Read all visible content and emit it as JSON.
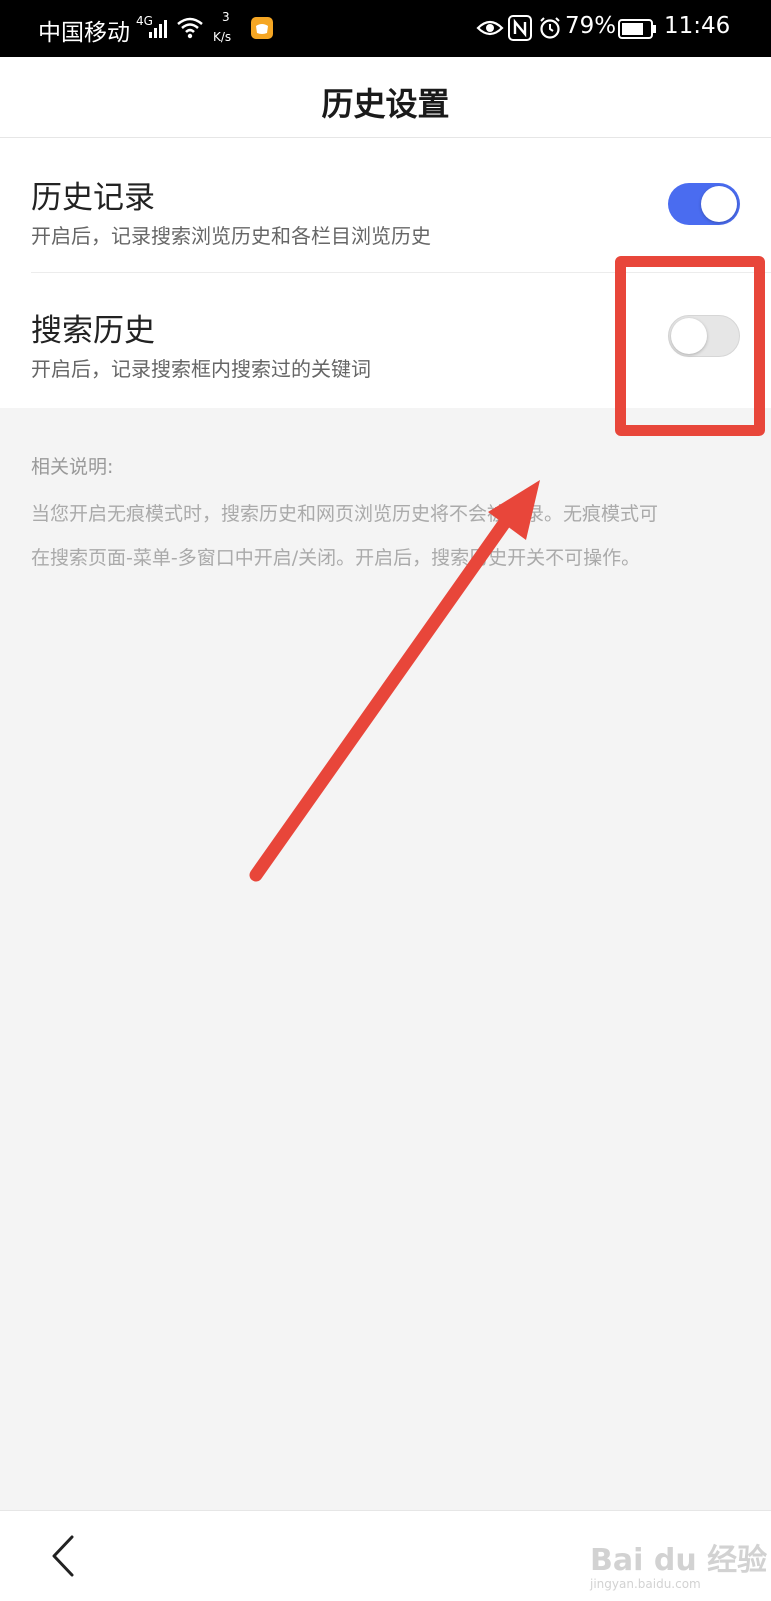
{
  "status_bar": {
    "carrier": "中国移动",
    "network": "4G",
    "speed_value": "3",
    "speed_unit": "K/s",
    "battery": "79%",
    "time": "11:46"
  },
  "header": {
    "title": "历史设置"
  },
  "settings": [
    {
      "label": "历史记录",
      "desc": "开启后，记录搜索浏览历史和各栏目浏览历史",
      "enabled": true
    },
    {
      "label": "搜索历史",
      "desc": "开启后，记录搜索框内搜索过的关键词",
      "enabled": false
    }
  ],
  "notes": {
    "title": "相关说明:",
    "line1": "当您开启无痕模式时，搜索历史和网页浏览历史将不会被记录。无痕模式可",
    "line2": "在搜索页面-菜单-多窗口中开启/关闭。开启后，搜索历史开关不可操作。"
  },
  "watermark": {
    "text": "Bai du 经验",
    "sub": "jingyan.baidu.com"
  },
  "colors": {
    "accent": "#4a6cf0",
    "annotation": "#e8463a"
  }
}
